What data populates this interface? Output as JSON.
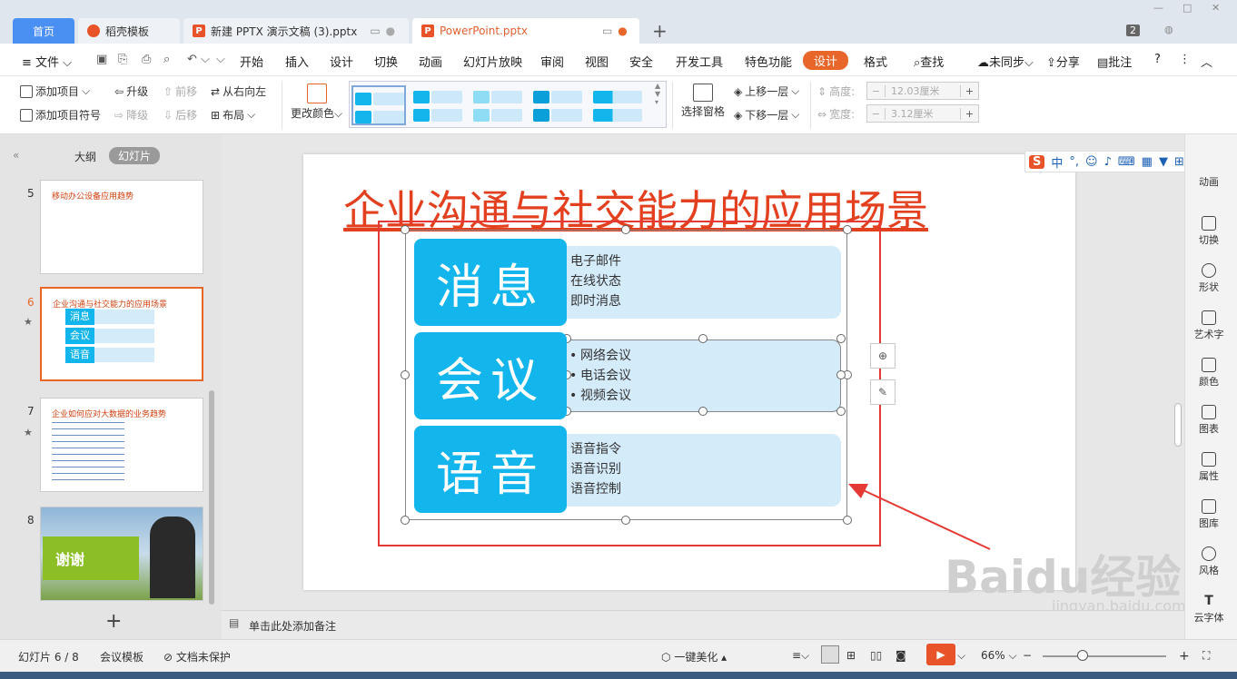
{
  "tabs": {
    "home": "首页",
    "t1": "稻壳模板",
    "t2": "新建 PPTX 演示文稿 (3).pptx",
    "t3": "PowerPoint.pptx",
    "add": "+",
    "badge": "2"
  },
  "menu": {
    "file": "文件",
    "items": [
      "开始",
      "插入",
      "设计",
      "切换",
      "动画",
      "幻灯片放映",
      "审阅",
      "视图",
      "安全",
      "开发工具",
      "特色功能",
      "设计",
      "格式"
    ],
    "search": "查找",
    "sync": "未同步",
    "share": "分享",
    "comment": "批注",
    "help": "?"
  },
  "ribbon": {
    "add_item": "添加项目",
    "add_bullet": "添加项目符号",
    "upgrade": "升级",
    "downgrade": "降级",
    "forward": "前移",
    "backward": "后移",
    "rtl": "从右向左",
    "layout": "布局",
    "change_color": "更改颜色",
    "selection_pane": "选择窗格",
    "move_up": "上移一层",
    "move_down": "下移一层",
    "height_label": "高度:",
    "height_value": "12.03厘米",
    "width_label": "宽度:",
    "width_value": "3.12厘米"
  },
  "left_panel": {
    "outline": "大纲",
    "slides": "幻灯片",
    "thumbs": [
      {
        "num": "5",
        "title": "移动办公设备应用趋势"
      },
      {
        "num": "6",
        "title": "企业沟通与社交能力的应用场景",
        "rows": [
          "消息",
          "会议",
          "语音"
        ]
      },
      {
        "num": "7",
        "title": "企业如何应对大数据的业务趋势"
      },
      {
        "num": "8",
        "title": "谢谢"
      }
    ]
  },
  "slide": {
    "title": "企业沟通与社交能力的应用场景",
    "rows": [
      {
        "label": "消息",
        "items": [
          "电子邮件",
          "在线状态",
          "即时消息"
        ]
      },
      {
        "label": "会议",
        "items": [
          "网络会议",
          "电话会议",
          "视频会议"
        ]
      },
      {
        "label": "语音",
        "items": [
          "语音指令",
          "语音识别",
          "语音控制"
        ]
      }
    ]
  },
  "ime": {
    "lang": "中",
    "punct": "°,"
  },
  "right_bar": [
    "动画",
    "切换",
    "形状",
    "艺术字",
    "颜色",
    "图表",
    "属性",
    "图库",
    "风格",
    "云字体"
  ],
  "notes": "单击此处添加备注",
  "status": {
    "slide_count": "幻灯片 6 / 8",
    "template": "会议模板",
    "protect": "文档未保护",
    "beautify": "一键美化",
    "zoom": "66%"
  },
  "watermark": {
    "brand": "Baidu经验",
    "url": "jingyan.baidu.com"
  }
}
